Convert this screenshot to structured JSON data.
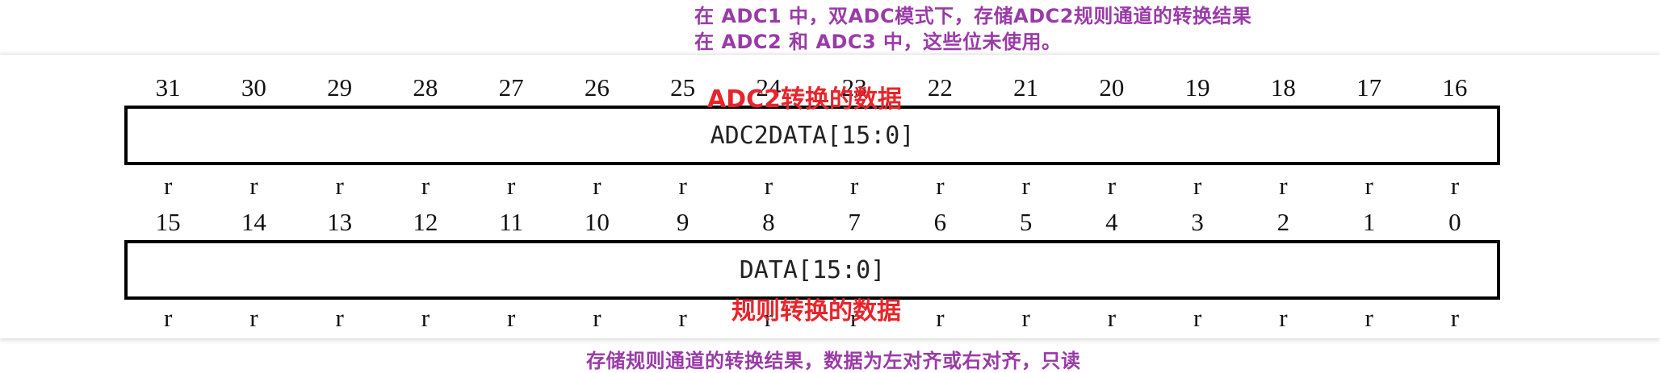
{
  "annotations": {
    "top_line1": "在 ADC1 中，双ADC模式下，存储ADC2规则通道的转换结果",
    "top_line2": "在 ADC2 和 ADC3 中，这些位未使用。",
    "adc2_label": "ADC2转换的数据",
    "regular_label": "规则转换的数据",
    "bottom_note": "存储规则通道的转换结果，数据为左对齐或右对齐，只读"
  },
  "upper_half": {
    "bit_numbers": [
      "31",
      "30",
      "29",
      "28",
      "27",
      "26",
      "25",
      "24",
      "23",
      "22",
      "21",
      "20",
      "19",
      "18",
      "17",
      "16"
    ],
    "field_name": "ADC2DATA[15:0]",
    "access": [
      "r",
      "r",
      "r",
      "r",
      "r",
      "r",
      "r",
      "r",
      "r",
      "r",
      "r",
      "r",
      "r",
      "r",
      "r",
      "r"
    ]
  },
  "lower_half": {
    "bit_numbers": [
      "15",
      "14",
      "13",
      "12",
      "11",
      "10",
      "9",
      "8",
      "7",
      "6",
      "5",
      "4",
      "3",
      "2",
      "1",
      "0"
    ],
    "field_name": "DATA[15:0]",
    "access": [
      "r",
      "r",
      "r",
      "r",
      "r",
      "r",
      "r",
      "r",
      "r",
      "r",
      "r",
      "r",
      "r",
      "r",
      "r",
      "r"
    ]
  },
  "colors": {
    "annotation_purple": "#9a3aa8",
    "annotation_red": "#e8242a",
    "border": "#000000"
  }
}
